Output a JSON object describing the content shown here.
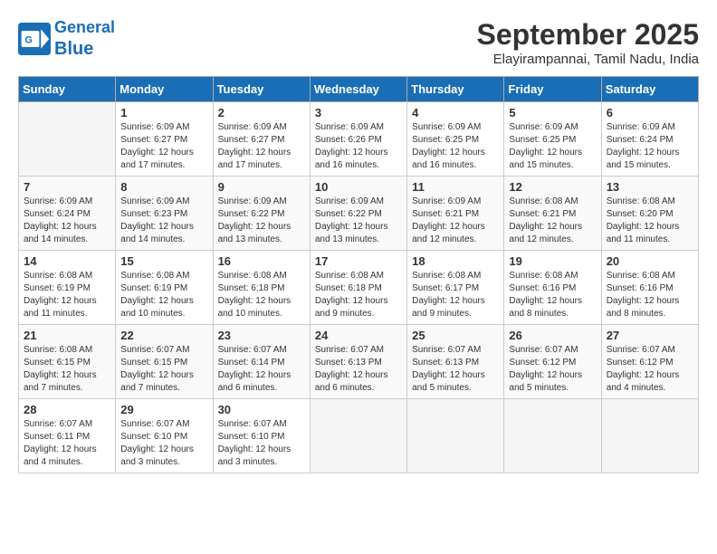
{
  "header": {
    "logo_line1": "General",
    "logo_line2": "Blue",
    "month": "September 2025",
    "location": "Elayirampannai, Tamil Nadu, India"
  },
  "days_of_week": [
    "Sunday",
    "Monday",
    "Tuesday",
    "Wednesday",
    "Thursday",
    "Friday",
    "Saturday"
  ],
  "weeks": [
    [
      {
        "num": "",
        "sunrise": "",
        "sunset": "",
        "daylight": ""
      },
      {
        "num": "1",
        "sunrise": "Sunrise: 6:09 AM",
        "sunset": "Sunset: 6:27 PM",
        "daylight": "Daylight: 12 hours and 17 minutes."
      },
      {
        "num": "2",
        "sunrise": "Sunrise: 6:09 AM",
        "sunset": "Sunset: 6:27 PM",
        "daylight": "Daylight: 12 hours and 17 minutes."
      },
      {
        "num": "3",
        "sunrise": "Sunrise: 6:09 AM",
        "sunset": "Sunset: 6:26 PM",
        "daylight": "Daylight: 12 hours and 16 minutes."
      },
      {
        "num": "4",
        "sunrise": "Sunrise: 6:09 AM",
        "sunset": "Sunset: 6:25 PM",
        "daylight": "Daylight: 12 hours and 16 minutes."
      },
      {
        "num": "5",
        "sunrise": "Sunrise: 6:09 AM",
        "sunset": "Sunset: 6:25 PM",
        "daylight": "Daylight: 12 hours and 15 minutes."
      },
      {
        "num": "6",
        "sunrise": "Sunrise: 6:09 AM",
        "sunset": "Sunset: 6:24 PM",
        "daylight": "Daylight: 12 hours and 15 minutes."
      }
    ],
    [
      {
        "num": "7",
        "sunrise": "Sunrise: 6:09 AM",
        "sunset": "Sunset: 6:24 PM",
        "daylight": "Daylight: 12 hours and 14 minutes."
      },
      {
        "num": "8",
        "sunrise": "Sunrise: 6:09 AM",
        "sunset": "Sunset: 6:23 PM",
        "daylight": "Daylight: 12 hours and 14 minutes."
      },
      {
        "num": "9",
        "sunrise": "Sunrise: 6:09 AM",
        "sunset": "Sunset: 6:22 PM",
        "daylight": "Daylight: 12 hours and 13 minutes."
      },
      {
        "num": "10",
        "sunrise": "Sunrise: 6:09 AM",
        "sunset": "Sunset: 6:22 PM",
        "daylight": "Daylight: 12 hours and 13 minutes."
      },
      {
        "num": "11",
        "sunrise": "Sunrise: 6:09 AM",
        "sunset": "Sunset: 6:21 PM",
        "daylight": "Daylight: 12 hours and 12 minutes."
      },
      {
        "num": "12",
        "sunrise": "Sunrise: 6:08 AM",
        "sunset": "Sunset: 6:21 PM",
        "daylight": "Daylight: 12 hours and 12 minutes."
      },
      {
        "num": "13",
        "sunrise": "Sunrise: 6:08 AM",
        "sunset": "Sunset: 6:20 PM",
        "daylight": "Daylight: 12 hours and 11 minutes."
      }
    ],
    [
      {
        "num": "14",
        "sunrise": "Sunrise: 6:08 AM",
        "sunset": "Sunset: 6:19 PM",
        "daylight": "Daylight: 12 hours and 11 minutes."
      },
      {
        "num": "15",
        "sunrise": "Sunrise: 6:08 AM",
        "sunset": "Sunset: 6:19 PM",
        "daylight": "Daylight: 12 hours and 10 minutes."
      },
      {
        "num": "16",
        "sunrise": "Sunrise: 6:08 AM",
        "sunset": "Sunset: 6:18 PM",
        "daylight": "Daylight: 12 hours and 10 minutes."
      },
      {
        "num": "17",
        "sunrise": "Sunrise: 6:08 AM",
        "sunset": "Sunset: 6:18 PM",
        "daylight": "Daylight: 12 hours and 9 minutes."
      },
      {
        "num": "18",
        "sunrise": "Sunrise: 6:08 AM",
        "sunset": "Sunset: 6:17 PM",
        "daylight": "Daylight: 12 hours and 9 minutes."
      },
      {
        "num": "19",
        "sunrise": "Sunrise: 6:08 AM",
        "sunset": "Sunset: 6:16 PM",
        "daylight": "Daylight: 12 hours and 8 minutes."
      },
      {
        "num": "20",
        "sunrise": "Sunrise: 6:08 AM",
        "sunset": "Sunset: 6:16 PM",
        "daylight": "Daylight: 12 hours and 8 minutes."
      }
    ],
    [
      {
        "num": "21",
        "sunrise": "Sunrise: 6:08 AM",
        "sunset": "Sunset: 6:15 PM",
        "daylight": "Daylight: 12 hours and 7 minutes."
      },
      {
        "num": "22",
        "sunrise": "Sunrise: 6:07 AM",
        "sunset": "Sunset: 6:15 PM",
        "daylight": "Daylight: 12 hours and 7 minutes."
      },
      {
        "num": "23",
        "sunrise": "Sunrise: 6:07 AM",
        "sunset": "Sunset: 6:14 PM",
        "daylight": "Daylight: 12 hours and 6 minutes."
      },
      {
        "num": "24",
        "sunrise": "Sunrise: 6:07 AM",
        "sunset": "Sunset: 6:13 PM",
        "daylight": "Daylight: 12 hours and 6 minutes."
      },
      {
        "num": "25",
        "sunrise": "Sunrise: 6:07 AM",
        "sunset": "Sunset: 6:13 PM",
        "daylight": "Daylight: 12 hours and 5 minutes."
      },
      {
        "num": "26",
        "sunrise": "Sunrise: 6:07 AM",
        "sunset": "Sunset: 6:12 PM",
        "daylight": "Daylight: 12 hours and 5 minutes."
      },
      {
        "num": "27",
        "sunrise": "Sunrise: 6:07 AM",
        "sunset": "Sunset: 6:12 PM",
        "daylight": "Daylight: 12 hours and 4 minutes."
      }
    ],
    [
      {
        "num": "28",
        "sunrise": "Sunrise: 6:07 AM",
        "sunset": "Sunset: 6:11 PM",
        "daylight": "Daylight: 12 hours and 4 minutes."
      },
      {
        "num": "29",
        "sunrise": "Sunrise: 6:07 AM",
        "sunset": "Sunset: 6:10 PM",
        "daylight": "Daylight: 12 hours and 3 minutes."
      },
      {
        "num": "30",
        "sunrise": "Sunrise: 6:07 AM",
        "sunset": "Sunset: 6:10 PM",
        "daylight": "Daylight: 12 hours and 3 minutes."
      },
      {
        "num": "",
        "sunrise": "",
        "sunset": "",
        "daylight": ""
      },
      {
        "num": "",
        "sunrise": "",
        "sunset": "",
        "daylight": ""
      },
      {
        "num": "",
        "sunrise": "",
        "sunset": "",
        "daylight": ""
      },
      {
        "num": "",
        "sunrise": "",
        "sunset": "",
        "daylight": ""
      }
    ]
  ]
}
